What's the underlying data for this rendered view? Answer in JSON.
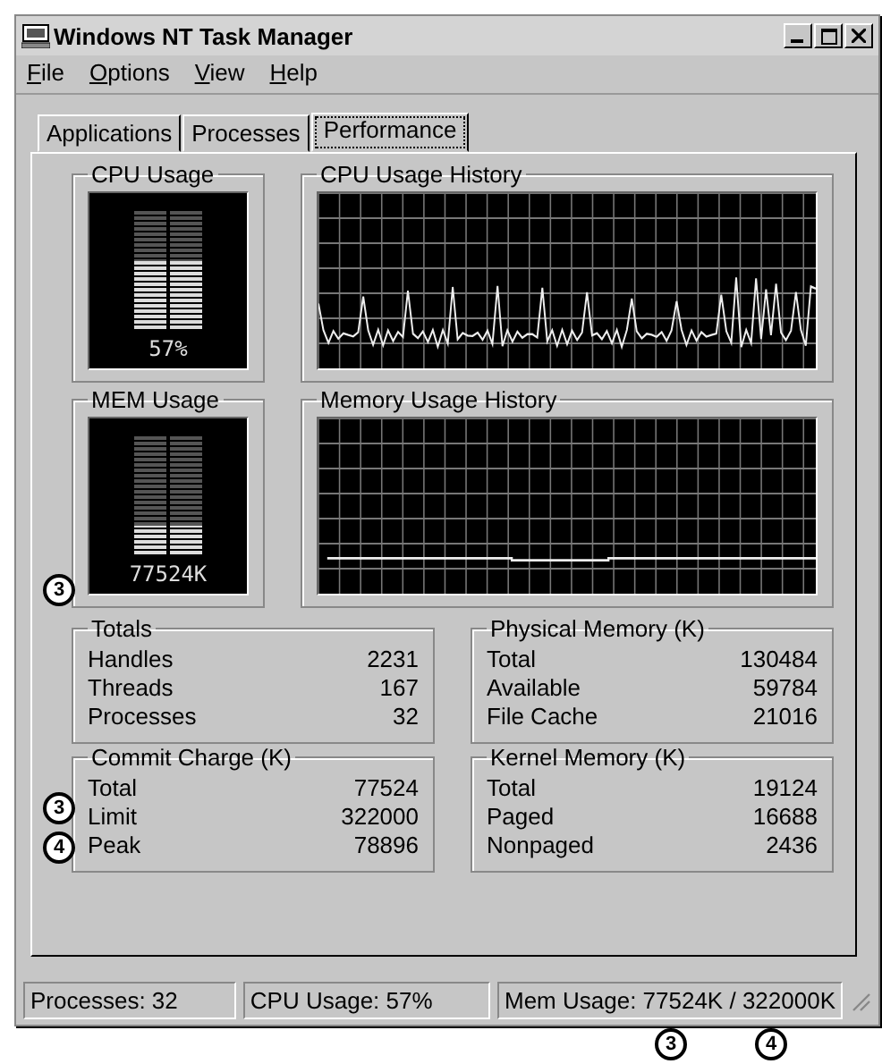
{
  "window": {
    "title": "Windows NT Task Manager"
  },
  "menu": [
    {
      "label": "File"
    },
    {
      "label": "Options"
    },
    {
      "label": "View"
    },
    {
      "label": "Help"
    }
  ],
  "tabs": [
    {
      "label": "Applications",
      "selected": false
    },
    {
      "label": "Processes",
      "selected": false
    },
    {
      "label": "Performance",
      "selected": true
    }
  ],
  "cpu_usage": {
    "title": "CPU Usage",
    "level": 0.57,
    "reading": "57%"
  },
  "cpu_history": {
    "title": "CPU Usage History"
  },
  "mem_usage": {
    "title": "MEM Usage",
    "level": 0.24,
    "reading": "77524K"
  },
  "memory_history": {
    "title": "Memory Usage History"
  },
  "groups": [
    {
      "title": "Totals",
      "rows": [
        {
          "label": "Handles",
          "value": "2231"
        },
        {
          "label": "Threads",
          "value": "167"
        },
        {
          "label": "Processes",
          "value": "32"
        }
      ]
    },
    {
      "title": "Physical Memory (K)",
      "rows": [
        {
          "label": "Total",
          "value": "130484"
        },
        {
          "label": "Available",
          "value": "59784"
        },
        {
          "label": "File Cache",
          "value": "21016"
        }
      ]
    },
    {
      "title": "Commit Charge (K)",
      "rows": [
        {
          "label": "Total",
          "value": "77524"
        },
        {
          "label": "Limit",
          "value": "322000"
        },
        {
          "label": "Peak",
          "value": "78896"
        }
      ]
    },
    {
      "title": "Kernel Memory (K)",
      "rows": [
        {
          "label": "Total",
          "value": "19124"
        },
        {
          "label": "Paged",
          "value": "16688"
        },
        {
          "label": "Nonpaged",
          "value": "2436"
        }
      ]
    }
  ],
  "status_bar": [
    "Processes: 32",
    "CPU Usage: 57%",
    "Mem Usage: 77524K / 322000K"
  ],
  "callouts": [
    {
      "number": "3"
    },
    {
      "number": "3"
    },
    {
      "number": "4"
    },
    {
      "number": "3"
    },
    {
      "number": "4"
    }
  ]
}
